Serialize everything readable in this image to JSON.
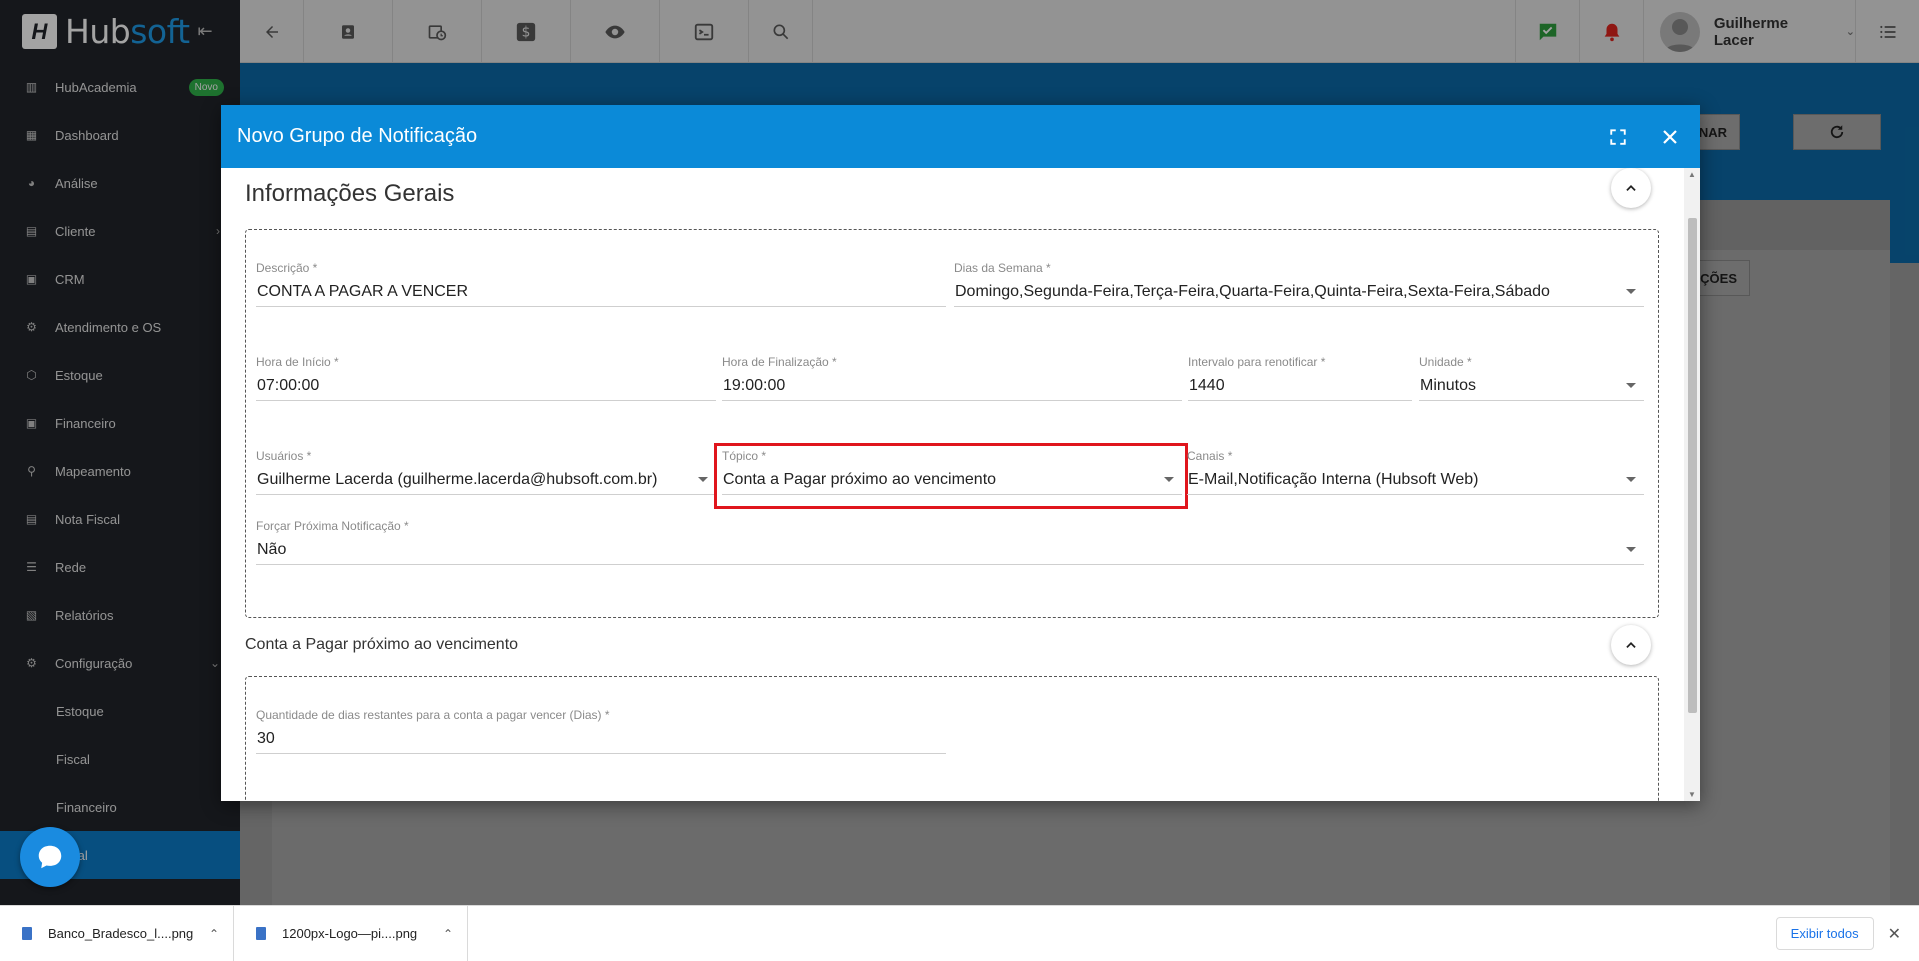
{
  "sidebar": {
    "logo": {
      "hub": "Hub",
      "soft": "soft"
    },
    "items": [
      {
        "label": "HubAcademia",
        "icon": "book-icon",
        "badge": "Novo"
      },
      {
        "label": "Dashboard",
        "icon": "dashboard-icon"
      },
      {
        "label": "Análise",
        "icon": "pie-chart-icon"
      },
      {
        "label": "Cliente",
        "icon": "contact-card-icon"
      },
      {
        "label": "CRM",
        "icon": "crm-icon"
      },
      {
        "label": "Atendimento e OS",
        "icon": "service-icon"
      },
      {
        "label": "Estoque",
        "icon": "box-icon"
      },
      {
        "label": "Financeiro",
        "icon": "money-icon"
      },
      {
        "label": "Mapeamento",
        "icon": "map-pin-icon"
      },
      {
        "label": "Nota Fiscal",
        "icon": "invoice-icon"
      },
      {
        "label": "Rede",
        "icon": "network-icon"
      },
      {
        "label": "Relatórios",
        "icon": "report-icon"
      },
      {
        "label": "Configuração",
        "icon": "gear-icon"
      }
    ],
    "subitems": [
      {
        "label": "Estoque"
      },
      {
        "label": "Fiscal"
      },
      {
        "label": "Financeiro"
      },
      {
        "label": "Geral"
      }
    ]
  },
  "topbar": {
    "user_name": "Guilherme Lacer"
  },
  "background": {
    "add_button": "ADICIONAR",
    "actions_button": "AÇÕES"
  },
  "modal": {
    "title": "Novo Grupo de Notificação",
    "section1_title": "Informações Gerais",
    "section2_title": "Conta a Pagar próximo ao vencimento",
    "fields": {
      "descricao": {
        "label": "Descrição *",
        "value": "CONTA A PAGAR A VENCER"
      },
      "dias_semana": {
        "label": "Dias da Semana *",
        "value": "Domingo,Segunda-Feira,Terça-Feira,Quarta-Feira,Quinta-Feira,Sexta-Feira,Sábado"
      },
      "hora_inicio": {
        "label": "Hora de Início *",
        "value": "07:00:00"
      },
      "hora_finalizacao": {
        "label": "Hora de Finalização *",
        "value": "19:00:00"
      },
      "intervalo": {
        "label": "Intervalo para renotificar *",
        "value": "1440"
      },
      "unidade": {
        "label": "Unidade *",
        "value": "Minutos"
      },
      "usuarios": {
        "label": "Usuários *",
        "value": "Guilherme Lacerda (guilherme.lacerda@hubsoft.com.br)"
      },
      "topico": {
        "label": "Tópico *",
        "value": "Conta a Pagar próximo ao vencimento"
      },
      "canais": {
        "label": "Canais *",
        "value": "E-Mail,Notificação Interna (Hubsoft Web)"
      },
      "forcar": {
        "label": "Forçar Próxima Notificação *",
        "value": "Não"
      },
      "qtd_dias": {
        "label": "Quantidade de dias restantes para a conta a pagar vencer (Dias) *",
        "value": "30"
      }
    }
  },
  "downloads": {
    "items": [
      {
        "name": "Banco_Bradesco_l....png"
      },
      {
        "name": "1200px-Logo—pi....png"
      }
    ],
    "show_all": "Exibir todos"
  },
  "colors": {
    "primary": "#0b8ad8",
    "sidebar": "#21252b",
    "highlight": "#e0161d",
    "badge": "#2fb34a"
  }
}
